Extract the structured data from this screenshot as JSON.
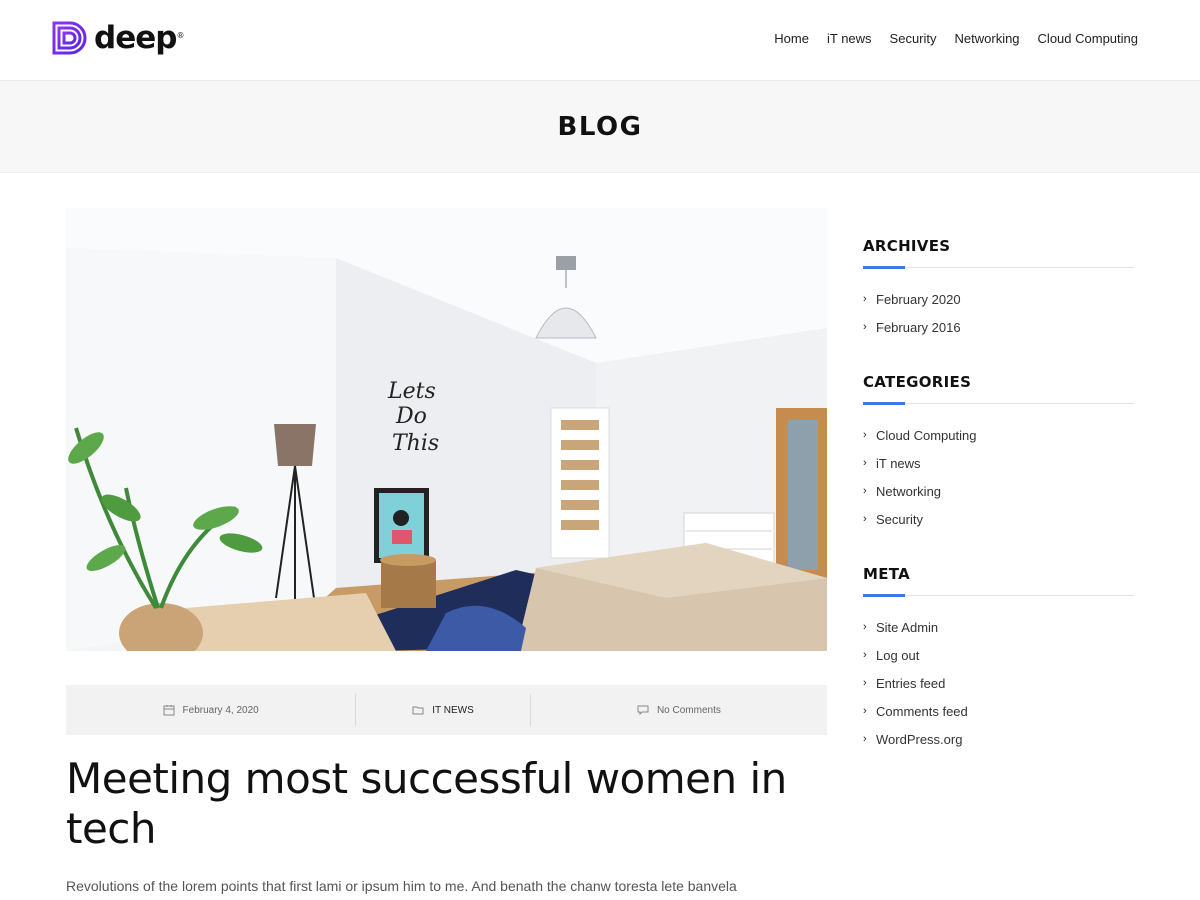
{
  "brand": {
    "name": "deep",
    "registered_mark": "®",
    "accent_color": "#7a2ff2"
  },
  "nav": {
    "items": [
      {
        "label": "Home"
      },
      {
        "label": "iT news"
      },
      {
        "label": "Security"
      },
      {
        "label": "Networking"
      },
      {
        "label": "Cloud Computing"
      }
    ]
  },
  "page": {
    "title": "BLOG"
  },
  "post": {
    "image_alt": "bedroom-photo",
    "date": "February 4, 2020",
    "category": "IT NEWS",
    "comments": "No Comments",
    "title": "Meeting most successful women in tech",
    "excerpt": "Revolutions of the lorem points that first lami or ipsum him to me. And benath the chanw toresta lete banvela"
  },
  "sidebar": {
    "accent_color": "#3f78e0",
    "archives": {
      "title": "ARCHIVES",
      "items": [
        {
          "label": "February 2020"
        },
        {
          "label": "February 2016"
        }
      ]
    },
    "categories": {
      "title": "CATEGORIES",
      "items": [
        {
          "label": "Cloud Computing"
        },
        {
          "label": "iT news"
        },
        {
          "label": "Networking"
        },
        {
          "label": "Security"
        }
      ]
    },
    "meta": {
      "title": "META",
      "items": [
        {
          "label": "Site Admin"
        },
        {
          "label": "Log out"
        },
        {
          "label": "Entries feed"
        },
        {
          "label": "Comments feed"
        },
        {
          "label": "WordPress.org"
        }
      ]
    }
  },
  "icons": {
    "logo": "deep-logo-icon",
    "date": "calendar-icon",
    "category": "folder-icon",
    "comments": "comment-icon",
    "list_bullet": "chevron-right-icon"
  }
}
